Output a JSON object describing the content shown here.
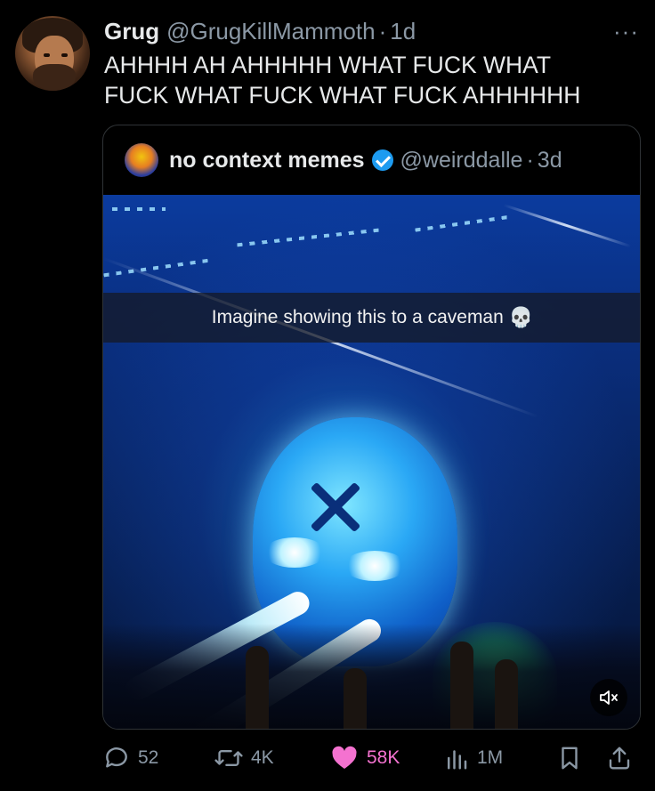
{
  "post": {
    "author_name": "Grug",
    "author_handle": "@GrugKillMammoth",
    "separator": "·",
    "age": "1d",
    "more_icon": "···",
    "text": "AHHHH AH AHHHHH WHAT FUCK WHAT FUCK WHAT FUCK WHAT FUCK AHHHHHH"
  },
  "quoted": {
    "author_name": "no context memes",
    "author_handle": "@weirddalle",
    "separator": "·",
    "age": "3d",
    "verified": true,
    "media": {
      "caption": "Imagine showing this to a caveman",
      "caption_emoji": "💀",
      "muted": true
    }
  },
  "actions": {
    "replies": "52",
    "reposts": "4K",
    "likes": "58K",
    "views": "1M"
  },
  "colors": {
    "background": "#000000",
    "text": "#e7e9ea",
    "secondary": "#8b98a5",
    "verified": "#1d9bf0",
    "like": "#f91880"
  }
}
